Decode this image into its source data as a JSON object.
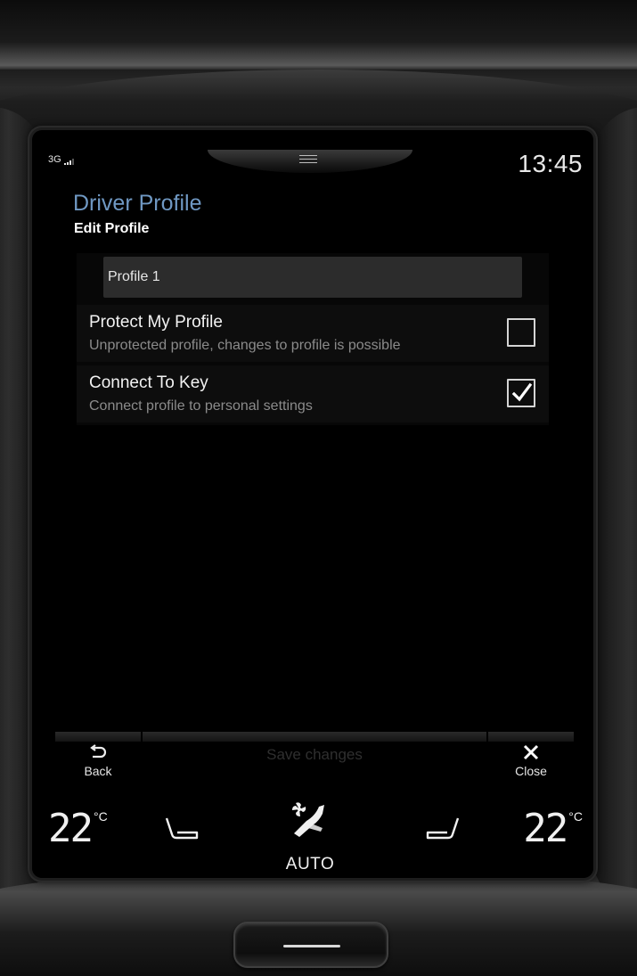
{
  "status": {
    "network": "3G",
    "time": "13:45"
  },
  "header": {
    "title": "Driver Profile",
    "subtitle": "Edit Profile"
  },
  "profile": {
    "name_value": "Profile 1"
  },
  "settings": [
    {
      "title": "Protect My Profile",
      "description": "Unprotected profile, changes to profile is possible",
      "checked": false
    },
    {
      "title": "Connect To Key",
      "description": "Connect profile to personal settings",
      "checked": true
    }
  ],
  "actions": {
    "back_label": "Back",
    "save_label": "Save changes",
    "close_label": "Close"
  },
  "climate": {
    "left_temp": "22",
    "right_temp": "22",
    "unit": "°C",
    "mode_label": "AUTO"
  },
  "icons": {
    "back": "back-arrow-icon",
    "close": "close-x-icon",
    "seat_left": "seat-left-icon",
    "seat_right": "seat-right-icon",
    "fan": "fan-airflow-icon",
    "pulldown": "pulldown-menu-icon"
  },
  "colors": {
    "accent_title": "#6f98c3",
    "text_primary": "#f2f2f2",
    "text_secondary": "#8b8b8b",
    "disabled": "#2f2f2f"
  }
}
